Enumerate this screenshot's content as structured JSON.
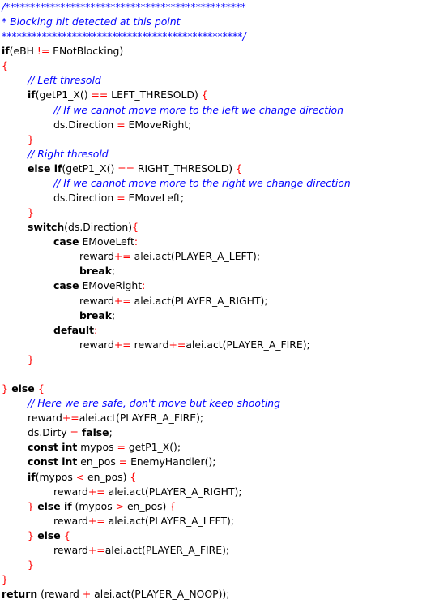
{
  "code_lines": [
    {
      "indent": 0,
      "tokens": [
        {
          "t": "/************************************************",
          "k": "comment"
        }
      ]
    },
    {
      "indent": 0,
      "tokens": [
        {
          "t": "* Blocking hit detected at this point",
          "k": "comment"
        }
      ]
    },
    {
      "indent": 0,
      "tokens": [
        {
          "t": "************************************************/",
          "k": "comment"
        }
      ]
    },
    {
      "indent": 0,
      "tokens": [
        {
          "t": "if",
          "k": "keyword"
        },
        {
          "t": "(eBH ",
          "k": "text"
        },
        {
          "t": "!=",
          "k": "op"
        },
        {
          "t": " ENotBlocking)",
          "k": "text"
        }
      ]
    },
    {
      "indent": 0,
      "tokens": [
        {
          "t": "{",
          "k": "brace"
        }
      ]
    },
    {
      "indent": 1,
      "tokens": [
        {
          "t": "// Left thresold",
          "k": "comment"
        }
      ]
    },
    {
      "indent": 1,
      "tokens": [
        {
          "t": "if",
          "k": "keyword"
        },
        {
          "t": "(getP1_X() ",
          "k": "text"
        },
        {
          "t": "==",
          "k": "op"
        },
        {
          "t": " LEFT_THRESOLD) ",
          "k": "text"
        },
        {
          "t": "{",
          "k": "brace"
        }
      ]
    },
    {
      "indent": 2,
      "tokens": [
        {
          "t": "// If we cannot move more to the left we change direction",
          "k": "comment"
        }
      ]
    },
    {
      "indent": 2,
      "tokens": [
        {
          "t": "ds.Direction ",
          "k": "text"
        },
        {
          "t": "=",
          "k": "op"
        },
        {
          "t": " EMoveRight;",
          "k": "text"
        }
      ]
    },
    {
      "indent": 1,
      "tokens": [
        {
          "t": "}",
          "k": "brace"
        }
      ]
    },
    {
      "indent": 1,
      "tokens": [
        {
          "t": "// Right thresold",
          "k": "comment"
        }
      ]
    },
    {
      "indent": 1,
      "tokens": [
        {
          "t": "else if",
          "k": "keyword"
        },
        {
          "t": "(getP1_X() ",
          "k": "text"
        },
        {
          "t": "==",
          "k": "op"
        },
        {
          "t": " RIGHT_THRESOLD) ",
          "k": "text"
        },
        {
          "t": "{",
          "k": "brace"
        }
      ]
    },
    {
      "indent": 2,
      "tokens": [
        {
          "t": "// If we cannot move more to the right we change direction",
          "k": "comment"
        }
      ]
    },
    {
      "indent": 2,
      "tokens": [
        {
          "t": "ds.Direction ",
          "k": "text"
        },
        {
          "t": "=",
          "k": "op"
        },
        {
          "t": " EMoveLeft;",
          "k": "text"
        }
      ]
    },
    {
      "indent": 1,
      "tokens": [
        {
          "t": "}",
          "k": "brace"
        }
      ]
    },
    {
      "indent": 1,
      "tokens": [
        {
          "t": "switch",
          "k": "keyword"
        },
        {
          "t": "(ds.Direction)",
          "k": "text"
        },
        {
          "t": "{",
          "k": "brace"
        }
      ]
    },
    {
      "indent": 2,
      "tokens": [
        {
          "t": "case",
          "k": "keyword"
        },
        {
          "t": " EMoveLeft",
          "k": "text"
        },
        {
          "t": ":",
          "k": "op"
        }
      ]
    },
    {
      "indent": 3,
      "tokens": [
        {
          "t": "reward",
          "k": "text"
        },
        {
          "t": "+=",
          "k": "op"
        },
        {
          "t": " alei.act(PLAYER_A_LEFT);",
          "k": "text"
        }
      ]
    },
    {
      "indent": 3,
      "tokens": [
        {
          "t": "break",
          "k": "keyword"
        },
        {
          "t": ";",
          "k": "text"
        }
      ]
    },
    {
      "indent": 2,
      "tokens": [
        {
          "t": "case",
          "k": "keyword"
        },
        {
          "t": " EMoveRight",
          "k": "text"
        },
        {
          "t": ":",
          "k": "op"
        }
      ]
    },
    {
      "indent": 3,
      "tokens": [
        {
          "t": "reward",
          "k": "text"
        },
        {
          "t": "+=",
          "k": "op"
        },
        {
          "t": " alei.act(PLAYER_A_RIGHT);",
          "k": "text"
        }
      ]
    },
    {
      "indent": 3,
      "tokens": [
        {
          "t": "break",
          "k": "keyword"
        },
        {
          "t": ";",
          "k": "text"
        }
      ]
    },
    {
      "indent": 2,
      "tokens": [
        {
          "t": "default",
          "k": "keyword"
        },
        {
          "t": ":",
          "k": "op"
        }
      ]
    },
    {
      "indent": 3,
      "tokens": [
        {
          "t": "reward",
          "k": "text"
        },
        {
          "t": "+=",
          "k": "op"
        },
        {
          "t": " reward",
          "k": "text"
        },
        {
          "t": "+=",
          "k": "op"
        },
        {
          "t": "alei.act(PLAYER_A_FIRE);",
          "k": "text"
        }
      ]
    },
    {
      "indent": 1,
      "tokens": [
        {
          "t": "}",
          "k": "brace"
        }
      ]
    },
    {
      "indent": 0,
      "tokens": []
    },
    {
      "indent": 0,
      "tokens": [
        {
          "t": "}",
          "k": "brace"
        },
        {
          "t": " else ",
          "k": "keyword"
        },
        {
          "t": "{",
          "k": "brace"
        }
      ]
    },
    {
      "indent": 1,
      "tokens": [
        {
          "t": "// Here we are safe, don't move but keep shooting",
          "k": "comment"
        }
      ]
    },
    {
      "indent": 1,
      "tokens": [
        {
          "t": "reward",
          "k": "text"
        },
        {
          "t": "+=",
          "k": "op"
        },
        {
          "t": "alei.act(PLAYER_A_FIRE);",
          "k": "text"
        }
      ]
    },
    {
      "indent": 1,
      "tokens": [
        {
          "t": "ds.Dirty ",
          "k": "text"
        },
        {
          "t": "=",
          "k": "op"
        },
        {
          "t": " ",
          "k": "text"
        },
        {
          "t": "false",
          "k": "keyword"
        },
        {
          "t": ";",
          "k": "text"
        }
      ]
    },
    {
      "indent": 1,
      "tokens": [
        {
          "t": "const int",
          "k": "keyword"
        },
        {
          "t": " mypos ",
          "k": "text"
        },
        {
          "t": "=",
          "k": "op"
        },
        {
          "t": " getP1_X();",
          "k": "text"
        }
      ]
    },
    {
      "indent": 1,
      "tokens": [
        {
          "t": "const int",
          "k": "keyword"
        },
        {
          "t": " en_pos ",
          "k": "text"
        },
        {
          "t": "=",
          "k": "op"
        },
        {
          "t": " EnemyHandler();",
          "k": "text"
        }
      ]
    },
    {
      "indent": 1,
      "tokens": [
        {
          "t": "if",
          "k": "keyword"
        },
        {
          "t": "(mypos ",
          "k": "text"
        },
        {
          "t": "<",
          "k": "op"
        },
        {
          "t": " en_pos) ",
          "k": "text"
        },
        {
          "t": "{",
          "k": "brace"
        }
      ]
    },
    {
      "indent": 2,
      "tokens": [
        {
          "t": "reward",
          "k": "text"
        },
        {
          "t": "+=",
          "k": "op"
        },
        {
          "t": " alei.act(PLAYER_A_RIGHT);",
          "k": "text"
        }
      ]
    },
    {
      "indent": 1,
      "tokens": [
        {
          "t": "}",
          "k": "brace"
        },
        {
          "t": " else if",
          "k": "keyword"
        },
        {
          "t": " (mypos ",
          "k": "text"
        },
        {
          "t": ">",
          "k": "op"
        },
        {
          "t": " en_pos) ",
          "k": "text"
        },
        {
          "t": "{",
          "k": "brace"
        }
      ]
    },
    {
      "indent": 2,
      "tokens": [
        {
          "t": "reward",
          "k": "text"
        },
        {
          "t": "+=",
          "k": "op"
        },
        {
          "t": " alei.act(PLAYER_A_LEFT);",
          "k": "text"
        }
      ]
    },
    {
      "indent": 1,
      "tokens": [
        {
          "t": "}",
          "k": "brace"
        },
        {
          "t": " else ",
          "k": "keyword"
        },
        {
          "t": "{",
          "k": "brace"
        }
      ]
    },
    {
      "indent": 2,
      "tokens": [
        {
          "t": "reward",
          "k": "text"
        },
        {
          "t": "+=",
          "k": "op"
        },
        {
          "t": "alei.act(PLAYER_A_FIRE);",
          "k": "text"
        }
      ]
    },
    {
      "indent": 1,
      "tokens": [
        {
          "t": "}",
          "k": "brace"
        }
      ]
    },
    {
      "indent": 0,
      "tokens": [
        {
          "t": "}",
          "k": "brace"
        }
      ]
    },
    {
      "indent": 0,
      "tokens": [
        {
          "t": "return",
          "k": "keyword"
        },
        {
          "t": " (reward ",
          "k": "text"
        },
        {
          "t": "+",
          "k": "op"
        },
        {
          "t": " alei.act(PLAYER_A_NOOP));",
          "k": "text"
        }
      ]
    }
  ],
  "colors": {
    "comment": "#0000ff",
    "operator": "#ff0000",
    "keyword": "#000000",
    "text": "#000000",
    "indent_guide": "#a0a0a0",
    "background": "#ffffff"
  }
}
